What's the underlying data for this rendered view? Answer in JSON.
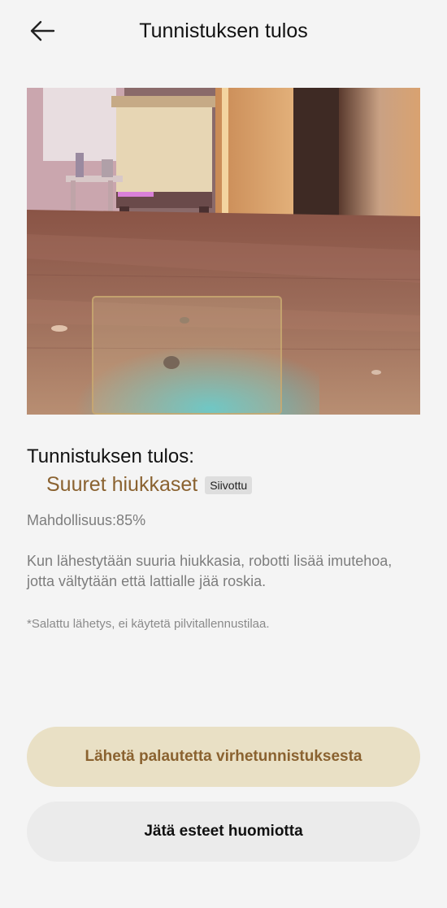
{
  "header": {
    "title": "Tunnistuksen tulos",
    "back_icon": "arrow-left-icon"
  },
  "photo": {
    "description_icon": "camera-image",
    "detection_box": true
  },
  "result": {
    "heading": "Tunnistuksen tulos:",
    "name": "Suuret hiukkaset",
    "badge": "Siivottu",
    "probability": "Mahdollisuus:85%",
    "description": "Kun lähestytään suuria hiukkasia, robotti lisää imutehoa, jotta vältytään että lattialle jää roskia.",
    "footnote": "*Salattu lähetys, ei käytetä pilvitallennustilaa."
  },
  "buttons": {
    "feedback": "Lähetä palautetta virhetunnistuksesta",
    "ignore": "Jätä esteet huomiotta"
  },
  "colors": {
    "accent": "#8a6230",
    "feedback_button_bg": "#e9e0c5",
    "ignore_button_bg": "#ebebeb",
    "page_bg": "#f4f4f4"
  }
}
